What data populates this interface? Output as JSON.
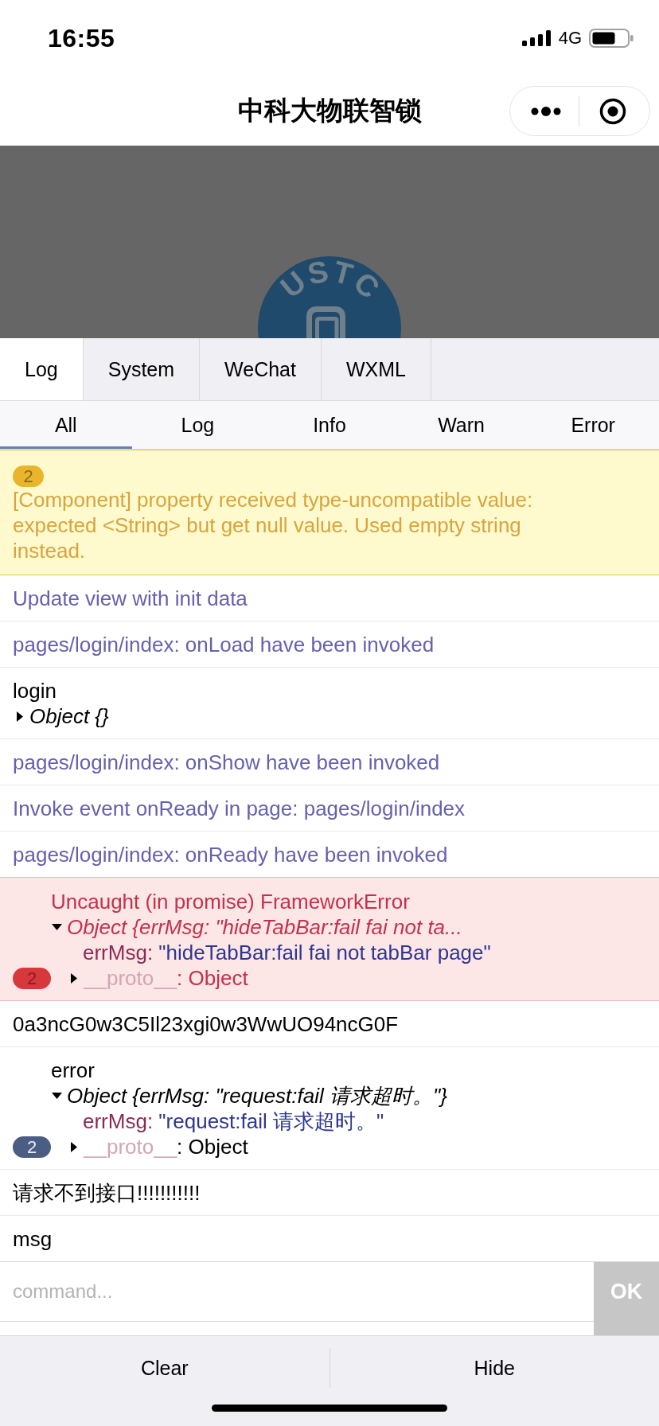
{
  "status_bar": {
    "time": "16:55",
    "network": "4G"
  },
  "nav_bar": {
    "title": "中科大物联智锁"
  },
  "page": {
    "logo_text": "USTC"
  },
  "console": {
    "tabs": [
      {
        "label": "Log",
        "selected": true
      },
      {
        "label": "System",
        "selected": false
      },
      {
        "label": "WeChat",
        "selected": false
      },
      {
        "label": "WXML",
        "selected": false
      }
    ],
    "filters": [
      {
        "label": "All",
        "selected": true
      },
      {
        "label": "Log",
        "selected": false
      },
      {
        "label": "Info",
        "selected": false
      },
      {
        "label": "Warn",
        "selected": false
      },
      {
        "label": "Error",
        "selected": false
      }
    ],
    "entries": [
      {
        "kind": "warn",
        "repeat": "2",
        "text": "[Component] property received type-uncompatible value: expected <String> but get null value. Used empty string instead."
      },
      {
        "kind": "info",
        "text": "Update view with init data"
      },
      {
        "kind": "info",
        "text": "pages/login/index: onLoad have been invoked"
      },
      {
        "kind": "log",
        "text": "login",
        "object": {
          "summary": "Object {}",
          "expanded": false
        }
      },
      {
        "kind": "info",
        "text": "pages/login/index: onShow have been invoked"
      },
      {
        "kind": "info",
        "text": "Invoke event onReady in page: pages/login/index"
      },
      {
        "kind": "info",
        "text": "pages/login/index: onReady have been invoked"
      },
      {
        "kind": "error",
        "repeat": "2",
        "text": "Uncaught (in promise) FrameworkError",
        "object": {
          "summary": "Object {errMsg: \"hideTabBar:fail fai not ta...",
          "expanded": true,
          "properties": [
            {
              "key": "errMsg:",
              "value": "\"hideTabBar:fail fai not tabBar page\""
            }
          ],
          "proto": {
            "label": "__proto__",
            "value": ": Object",
            "expanded": false
          }
        }
      },
      {
        "kind": "log",
        "text": "0a3ncG0w3C5Il23xgi0w3WwUO94ncG0F"
      },
      {
        "kind": "log",
        "repeat": "2",
        "text": "error",
        "object": {
          "summary": "Object {errMsg: \"request:fail 请求超时。\"}",
          "expanded": true,
          "properties": [
            {
              "key": "errMsg:",
              "value": "\"request:fail 请求超时。\""
            }
          ],
          "proto": {
            "label": "__proto__",
            "value": ": Object",
            "expanded": false
          }
        }
      },
      {
        "kind": "log",
        "text": "请求不到接口!!!!!!!!!!!"
      },
      {
        "kind": "log",
        "text": "msg"
      }
    ],
    "command": {
      "placeholder": "command...",
      "button": "OK"
    },
    "footer": [
      "Clear",
      "Hide"
    ]
  }
}
